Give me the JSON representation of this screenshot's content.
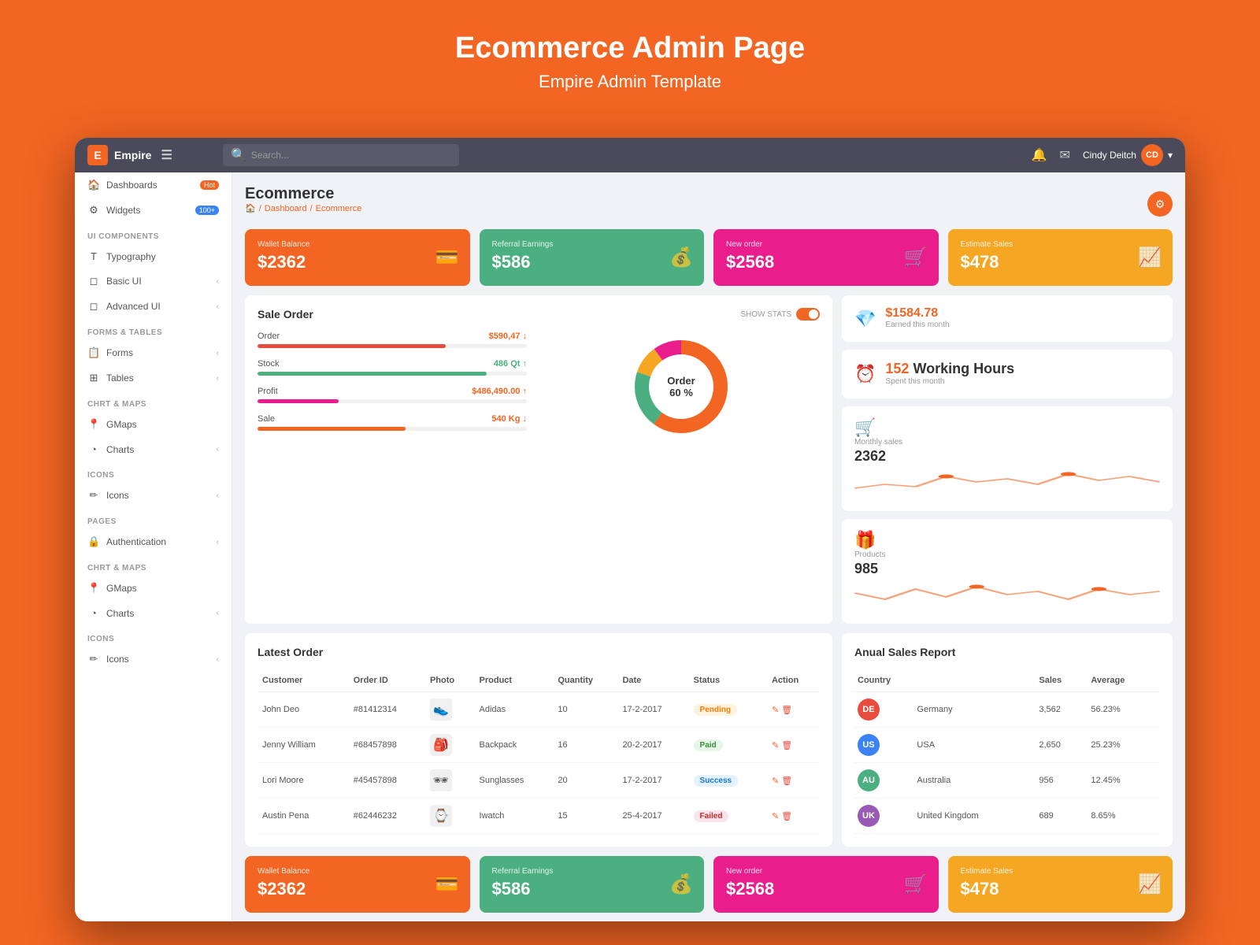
{
  "page": {
    "title": "Ecommerce Admin Page",
    "subtitle": "Empire  Admin Template"
  },
  "topbar": {
    "logo_label": "Empire",
    "search_placeholder": "Search...",
    "user_name": "Cindy Deitch"
  },
  "sidebar": {
    "sections": [
      {
        "title": "",
        "items": [
          {
            "id": "dashboards",
            "label": "Dashboards",
            "icon": "🏠",
            "badge": "Hot",
            "badge_type": "orange",
            "has_chevron": true
          },
          {
            "id": "widgets",
            "label": "Widgets",
            "icon": "⚙",
            "badge": "100+",
            "badge_type": "blue",
            "has_chevron": true
          }
        ]
      },
      {
        "title": "UI Components",
        "items": [
          {
            "id": "typography",
            "label": "Typography",
            "icon": "T",
            "has_chevron": false
          },
          {
            "id": "basic-ui",
            "label": "Basic UI",
            "icon": "◻",
            "has_chevron": true
          },
          {
            "id": "advanced-ui",
            "label": "Advanced UI",
            "icon": "◻",
            "has_chevron": true
          }
        ]
      },
      {
        "title": "Forms & Tables",
        "items": [
          {
            "id": "forms",
            "label": "Forms",
            "icon": "📋",
            "has_chevron": true
          },
          {
            "id": "tables",
            "label": "Tables",
            "icon": "⊞",
            "has_chevron": true
          }
        ]
      },
      {
        "title": "Chrt & Maps",
        "items": [
          {
            "id": "gmaps",
            "label": "GMaps",
            "icon": "📍",
            "has_chevron": false
          },
          {
            "id": "charts1",
            "label": "Charts",
            "icon": "◔",
            "has_chevron": true
          }
        ]
      },
      {
        "title": "Icons",
        "items": [
          {
            "id": "icons1",
            "label": "Icons",
            "icon": "✏",
            "has_chevron": true
          }
        ]
      },
      {
        "title": "Pages",
        "items": [
          {
            "id": "authentication",
            "label": "Authentication",
            "icon": "🔒",
            "has_chevron": true
          }
        ]
      },
      {
        "title": "Chrt & Maps",
        "items": [
          {
            "id": "gmaps2",
            "label": "GMaps",
            "icon": "📍",
            "has_chevron": false
          },
          {
            "id": "charts2",
            "label": "Charts",
            "icon": "◔",
            "has_chevron": true
          }
        ]
      },
      {
        "title": "Icons",
        "items": [
          {
            "id": "icons2",
            "label": "Icons",
            "icon": "✏",
            "has_chevron": true
          }
        ]
      }
    ]
  },
  "breadcrumb": {
    "home": "🏠",
    "dashboard": "Dashboard",
    "current": "Ecommerce"
  },
  "stat_cards": [
    {
      "id": "wallet",
      "label": "Wallet Balance",
      "value": "$2362",
      "color": "orange",
      "icon": "💳"
    },
    {
      "id": "referral",
      "label": "Referral Earnings",
      "value": "$586",
      "color": "green",
      "icon": "💰"
    },
    {
      "id": "new-order",
      "label": "New order",
      "value": "$2568",
      "color": "pink",
      "icon": "🛒"
    },
    {
      "id": "estimate",
      "label": "Estimate Sales",
      "value": "$478",
      "color": "yellow",
      "icon": "📈"
    }
  ],
  "sale_order": {
    "title": "Sale Order",
    "show_stats": "SHOW STATS",
    "items": [
      {
        "label": "Order",
        "value": "$590,47 ↓",
        "fill": 70,
        "bar_class": "red"
      },
      {
        "label": "Stock",
        "value": "486 Qt ↑",
        "fill": 85,
        "bar_class": "green"
      },
      {
        "label": "Profit",
        "value": "$486,490.00 ↑",
        "fill": 30,
        "bar_class": "pink"
      },
      {
        "label": "Sale",
        "value": "540 Kg ↓",
        "fill": 55,
        "bar_class": "orange"
      }
    ],
    "donut": {
      "label": "Order",
      "percent": "60 %"
    }
  },
  "right_stats": [
    {
      "id": "earned",
      "label": "Earned this month",
      "value": "$1584.78",
      "icon": "💎"
    },
    {
      "id": "working-hours",
      "label": "Spent this month",
      "value": "152",
      "value_suffix": " Working Hours",
      "icon": "⏰"
    },
    {
      "id": "monthly-sales",
      "label": "Monthly sales",
      "value": "2362",
      "icon": "🛒"
    },
    {
      "id": "products",
      "label": "Products",
      "value": "985",
      "icon": "🎁"
    }
  ],
  "latest_order": {
    "title": "Latest Order",
    "columns": [
      "Customer",
      "Order ID",
      "Photo",
      "Product",
      "Quantity",
      "Date",
      "Status",
      "Action"
    ],
    "rows": [
      {
        "customer": "John Deo",
        "order_id": "#81412314",
        "photo": "👟",
        "product": "Adidas",
        "quantity": "10",
        "date": "17-2-2017",
        "status": "Pending",
        "status_class": "status-pending"
      },
      {
        "customer": "Jenny William",
        "order_id": "#68457898",
        "photo": "🎒",
        "product": "Backpack",
        "quantity": "16",
        "date": "20-2-2017",
        "status": "Paid",
        "status_class": "status-paid"
      },
      {
        "customer": "Lori Moore",
        "order_id": "#45457898",
        "photo": "🕶",
        "product": "Sunglasses",
        "quantity": "20",
        "date": "17-2-2017",
        "status": "Success",
        "status_class": "status-success"
      },
      {
        "customer": "Austin Pena",
        "order_id": "#62446232",
        "photo": "⌚",
        "product": "Iwatch",
        "quantity": "15",
        "date": "25-4-2017",
        "status": "Failed",
        "status_class": "status-failed"
      }
    ]
  },
  "annual_report": {
    "title": "Anual Sales Report",
    "columns": [
      "Country",
      "Sales",
      "Average"
    ],
    "rows": [
      {
        "country": "Germany",
        "avatar_class": "ca-de",
        "initials": "DE",
        "sales": "3,562",
        "average": "56.23%"
      },
      {
        "country": "USA",
        "avatar_class": "ca-us",
        "initials": "US",
        "sales": "2,650",
        "average": "25.23%"
      },
      {
        "country": "Australia",
        "avatar_class": "ca-au",
        "initials": "AU",
        "sales": "956",
        "average": "12.45%"
      },
      {
        "country": "United Kingdom",
        "avatar_class": "ca-uk",
        "initials": "UK",
        "sales": "689",
        "average": "8.65%"
      }
    ]
  },
  "bottom_cards": [
    {
      "id": "wallet2",
      "label": "Wallet Balance",
      "value": "$2362",
      "color": "orange",
      "icon": "💳"
    },
    {
      "id": "referral2",
      "label": "Referral Earnings",
      "value": "$586",
      "color": "green",
      "icon": "💰"
    },
    {
      "id": "new-order2",
      "label": "New order",
      "value": "$2568",
      "color": "pink",
      "icon": "🛒"
    },
    {
      "id": "estimate2",
      "label": "Estimate Sales",
      "value": "$478",
      "color": "yellow",
      "icon": "📈"
    }
  ]
}
